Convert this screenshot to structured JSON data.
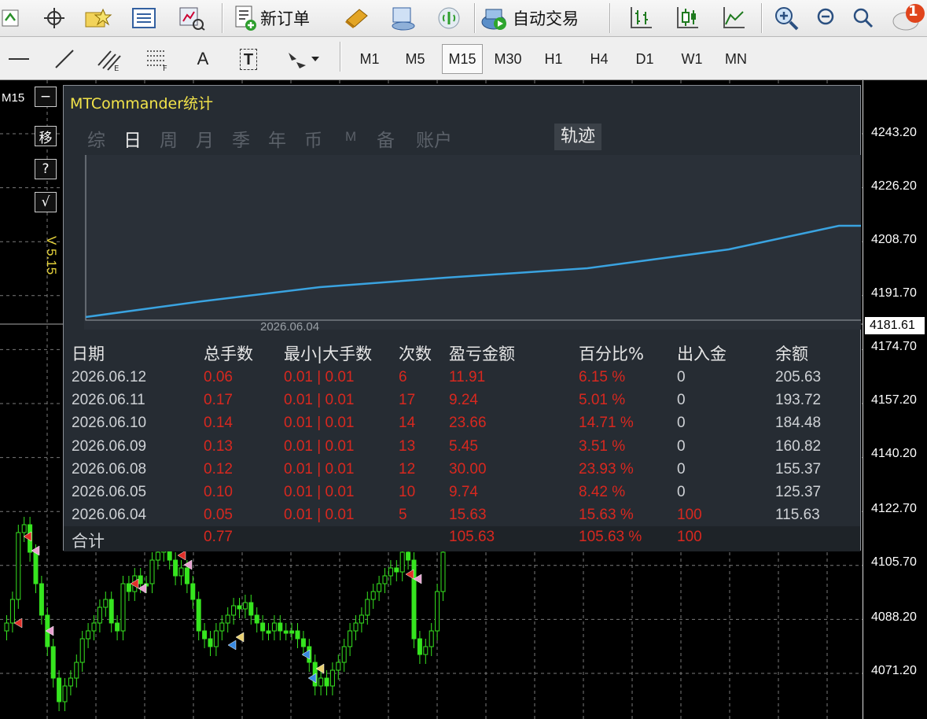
{
  "toolbar": {
    "new_order_label": "新订单",
    "autotrade_label": "自动交易",
    "notification_count": "1"
  },
  "timeframes": [
    {
      "label": "M1",
      "active": false
    },
    {
      "label": "M5",
      "active": false
    },
    {
      "label": "M15",
      "active": true
    },
    {
      "label": "M30",
      "active": false
    },
    {
      "label": "H1",
      "active": false
    },
    {
      "label": "H4",
      "active": false
    },
    {
      "label": "D1",
      "active": false
    },
    {
      "label": "W1",
      "active": false
    },
    {
      "label": "MN",
      "active": false
    }
  ],
  "draw_tools": {
    "text_label": "A",
    "text_box_label": "T"
  },
  "chart": {
    "timeframe": "M15",
    "side_buttons": [
      "−",
      "移",
      "?",
      "√"
    ],
    "version": "V 5.15",
    "current_price": "4181.61",
    "price_labels": [
      "4243.20",
      "4226.20",
      "4208.70",
      "4191.70",
      "4174.70",
      "4157.20",
      "4140.20",
      "4122.70",
      "4105.70",
      "4088.20",
      "4071.20"
    ]
  },
  "panel": {
    "title": "MTCommander统计",
    "tabs": [
      {
        "label": "综",
        "active": false
      },
      {
        "label": "日",
        "active": true
      },
      {
        "label": "周",
        "active": false
      },
      {
        "label": "月",
        "active": false
      },
      {
        "label": "季",
        "active": false
      },
      {
        "label": "年",
        "active": false
      },
      {
        "label": "币",
        "active": false
      },
      {
        "label": "M",
        "active": false
      },
      {
        "label": "备",
        "active": false
      },
      {
        "label": "账户",
        "active": false
      }
    ],
    "track_label": "轨迹",
    "graph_date": "2026.06.04",
    "headers": [
      "日期",
      "总手数",
      "最小|大手数",
      "次数",
      "盈亏金额",
      "百分比%",
      "出入金",
      "余额"
    ],
    "rows": [
      [
        "2026.06.12",
        "0.06",
        "0.01 | 0.01",
        "6",
        "11.91",
        "6.15 %",
        "0",
        "205.63"
      ],
      [
        "2026.06.11",
        "0.17",
        "0.01 | 0.01",
        "17",
        "9.24",
        "5.01 %",
        "0",
        "193.72"
      ],
      [
        "2026.06.10",
        "0.14",
        "0.01 | 0.01",
        "14",
        "23.66",
        "14.71 %",
        "0",
        "184.48"
      ],
      [
        "2026.06.09",
        "0.13",
        "0.01 | 0.01",
        "13",
        "5.45",
        "3.51 %",
        "0",
        "160.82"
      ],
      [
        "2026.06.08",
        "0.12",
        "0.01 | 0.01",
        "12",
        "30.00",
        "23.93 %",
        "0",
        "155.37"
      ],
      [
        "2026.06.05",
        "0.10",
        "0.01 | 0.01",
        "10",
        "9.74",
        "8.42 %",
        "0",
        "125.37"
      ],
      [
        "2026.06.04",
        "0.05",
        "0.01 | 0.01",
        "5",
        "15.63",
        "15.63 %",
        "100",
        "115.63"
      ]
    ],
    "total": {
      "label": "合计",
      "lots": "0.77",
      "profit": "105.63",
      "percent": "105.63 %",
      "deposit": "100"
    }
  },
  "colors": {
    "candle_green": "#36e51f",
    "profit_red": "#d8281f",
    "equity_line": "#3aa3e0",
    "panel_bg": "#262c33",
    "title_yellow": "#f2e34a"
  }
}
